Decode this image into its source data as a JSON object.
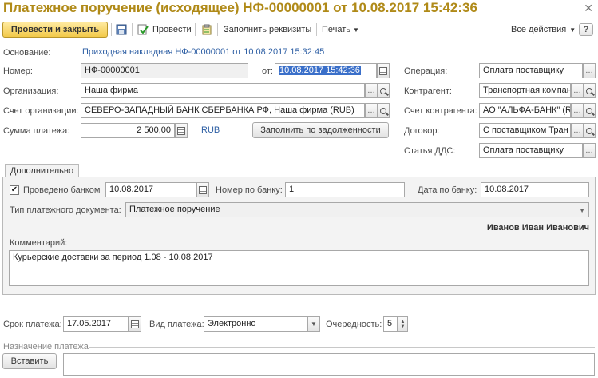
{
  "window": {
    "title": "Платежное поручение (исходящее) НФ-00000001 от 10.08.2017 15:42:36"
  },
  "toolbar": {
    "post_and_close": "Провести и закрыть",
    "post": "Провести",
    "fill_details": "Заполнить реквизиты",
    "print": "Печать",
    "all_actions": "Все действия",
    "help": "?"
  },
  "basis": {
    "label": "Основание:",
    "value": "Приходная накладная НФ-00000001 от 10.08.2017 15:32:45"
  },
  "left": {
    "number_label": "Номер:",
    "number_value": "НФ-00000001",
    "date_label": "от:",
    "date_value": "10.08.2017 15:42:36",
    "org_label": "Организация:",
    "org_value": "Наша фирма",
    "org_account_label": "Счет организации:",
    "org_account_value": "СЕВЕРО-ЗАПАДНЫЙ БАНК СБЕРБАНКА РФ, Наша фирма (RUB)",
    "sum_label": "Сумма платежа:",
    "sum_value": "2 500,00",
    "currency": "RUB",
    "fill_debt_button": "Заполнить по задолженности"
  },
  "right": {
    "operation_label": "Операция:",
    "operation_value": "Оплата поставщику",
    "counterparty_label": "Контрагент:",
    "counterparty_value": "Транспортная компан",
    "cp_account_label": "Счет контрагента:",
    "cp_account_value": "АО \"АЛЬФА-БАНК\" (R",
    "contract_label": "Договор:",
    "contract_value": "С поставщиком Тран",
    "dds_label": "Статья ДДС:",
    "dds_value": "Оплата поставщику"
  },
  "extra_tab": {
    "tab_label": "Дополнительно",
    "paid_by_bank_label": "Проведено банком",
    "paid_by_bank_checked": true,
    "paid_by_bank_date": "10.08.2017",
    "bank_number_label": "Номер по банку:",
    "bank_number_value": "1",
    "bank_date_label": "Дата по банку:",
    "bank_date_value": "10.08.2017",
    "doc_type_label": "Тип платежного документа:",
    "doc_type_value": "Платежное поручение",
    "responsible": "Иванов Иван Иванович",
    "comment_label": "Комментарий:",
    "comment_value": "Курьерские доставки за период 1.08 - 10.08.2017"
  },
  "bottom": {
    "due_label": "Срок платежа:",
    "due_value": "17.05.2017",
    "kind_label": "Вид платежа:",
    "kind_value": "Электронно",
    "priority_label": "Очередность:",
    "priority_value": "5",
    "purpose_group": "Назначение платежа",
    "insert_button": "Вставить"
  }
}
